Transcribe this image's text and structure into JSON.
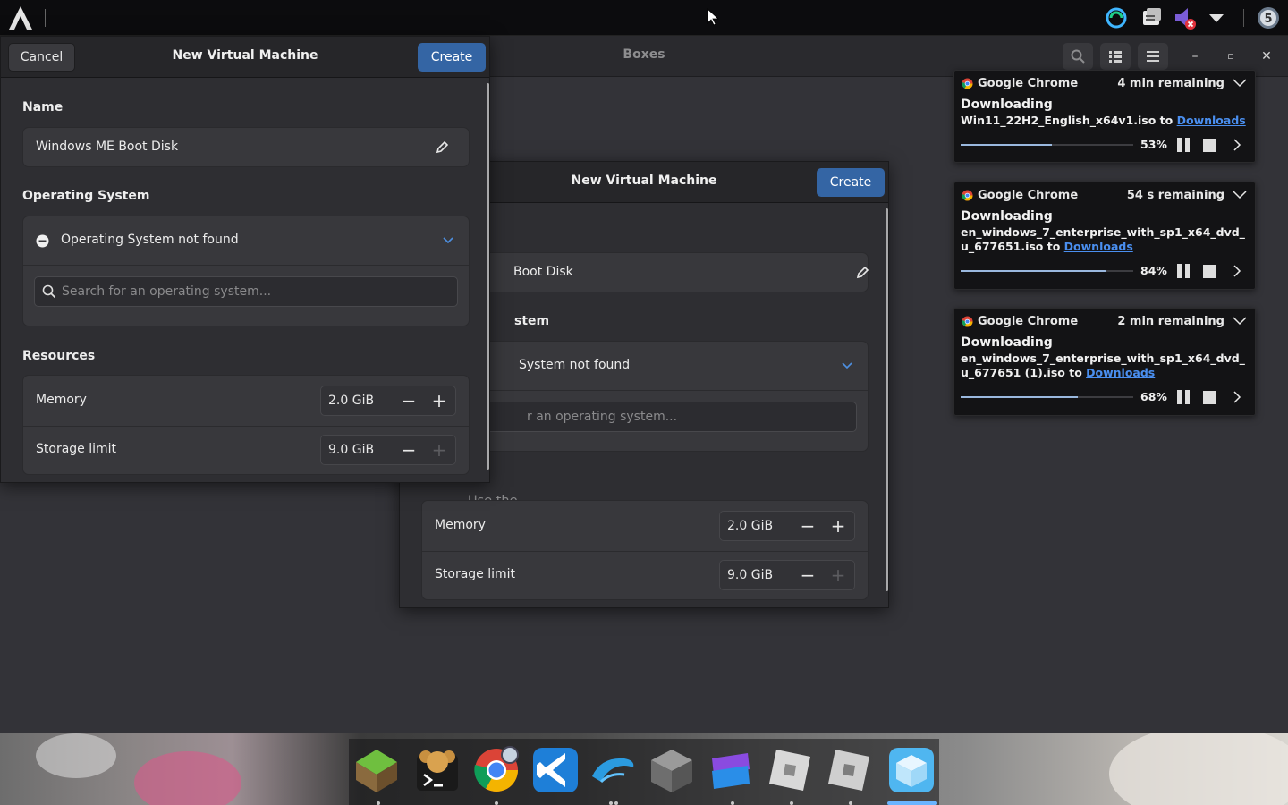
{
  "boxes": {
    "title": "Boxes"
  },
  "front_dialog": {
    "cancel_label": "Cancel",
    "title": "New Virtual Machine",
    "create_label": "Create",
    "name_label": "Name",
    "name_value": "Windows ME Boot Disk",
    "os_label": "Operating System",
    "os_value": "Operating System not found",
    "search_placeholder": "Search for an operating system...",
    "resources_label": "Resources",
    "memory_label": "Memory",
    "memory_value": "2.0 GiB",
    "storage_label": "Storage limit",
    "storage_value": "9.0 GiB"
  },
  "back_dialog": {
    "title": "New Virtual Machine",
    "create_label": "Create",
    "name_fragment": "Boot Disk",
    "os_heading_fragment": "stem",
    "os_fragment": "System not found",
    "search_fragment": "r an operating system...",
    "use_fragment": "Use the",
    "memory_label": "Memory",
    "memory_value": "2.0 GiB",
    "storage_label": "Storage limit",
    "storage_value": "9.0 GiB"
  },
  "notifications": [
    {
      "app": "Google Chrome",
      "remaining": "4 min remaining",
      "title": "Downloading",
      "file": "Win11_22H2_English_x64v1.iso to ",
      "link": "Downloads",
      "progress": 0.53,
      "percent": "53%"
    },
    {
      "app": "Google Chrome",
      "remaining": "54 s remaining",
      "title": "Downloading",
      "file": "en_windows_7_enterprise_with_sp1_x64_dvd_u_677651.iso to ",
      "link": "Downloads",
      "progress": 0.84,
      "percent": "84%"
    },
    {
      "app": "Google Chrome",
      "remaining": "2 min remaining",
      "title": "Downloading",
      "file": "en_windows_7_enterprise_with_sp1_x64_dvd_u_677651 (1).iso to ",
      "link": "Downloads",
      "progress": 0.68,
      "percent": "68%"
    }
  ],
  "tray": {
    "badge": "5"
  },
  "colors": {
    "accent": "#3465a4",
    "link": "#4a8ff0",
    "progress": "#9ab8de",
    "dock_active": "#6ab4ff"
  }
}
